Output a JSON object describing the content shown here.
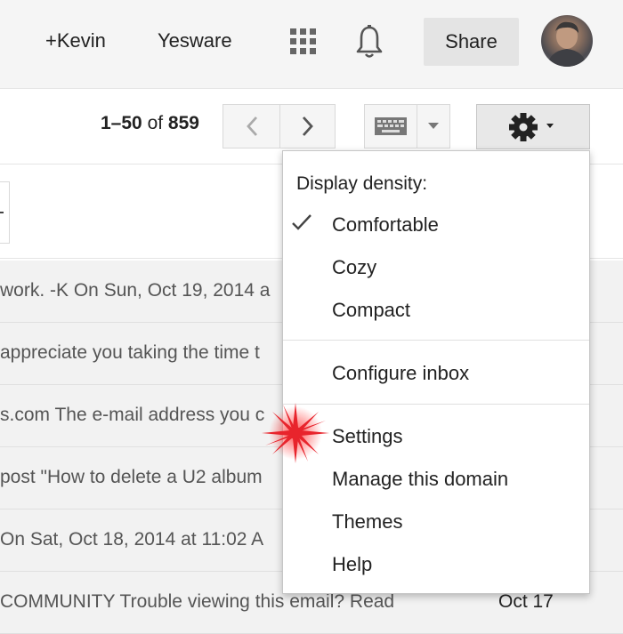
{
  "header": {
    "profile_link": "+Kevin",
    "yesware_link": "Yesware",
    "share_label": "Share",
    "icons": [
      "apps-grid-icon",
      "notification-bell-icon"
    ]
  },
  "toolbar": {
    "pager_range": "1–50",
    "pager_of": "of",
    "pager_total": "859",
    "icons": [
      "chevron-left-icon",
      "chevron-right-icon",
      "keyboard-icon",
      "caret-down-icon",
      "gear-icon"
    ]
  },
  "inbox": {
    "rows": [
      {
        "snippet": "work. -K On Sun, Oct 19, 2014 a",
        "date": ""
      },
      {
        "snippet": "appreciate you taking the time t",
        "date": ""
      },
      {
        "snippet": "s.com The e-mail address you c",
        "date": ""
      },
      {
        "snippet": " post \"How to delete a U2 album",
        "date": ""
      },
      {
        "snippet": "On Sat, Oct 18, 2014 at 11:02 A",
        "date": ""
      },
      {
        "snippet": "COMMUNITY Trouble viewing this email? Read",
        "date": "Oct 17"
      }
    ]
  },
  "settings_menu": {
    "header": "Display density:",
    "density_options": [
      "Comfortable",
      "Cozy",
      "Compact"
    ],
    "selected_density": "Comfortable",
    "configure_inbox": "Configure inbox",
    "settings": "Settings",
    "manage_domain": "Manage this domain",
    "themes": "Themes",
    "help": "Help"
  },
  "colors": {
    "topbar_bg": "#f5f5f5",
    "row_bg": "#f2f2f2",
    "click_marker": "#e8242c"
  }
}
